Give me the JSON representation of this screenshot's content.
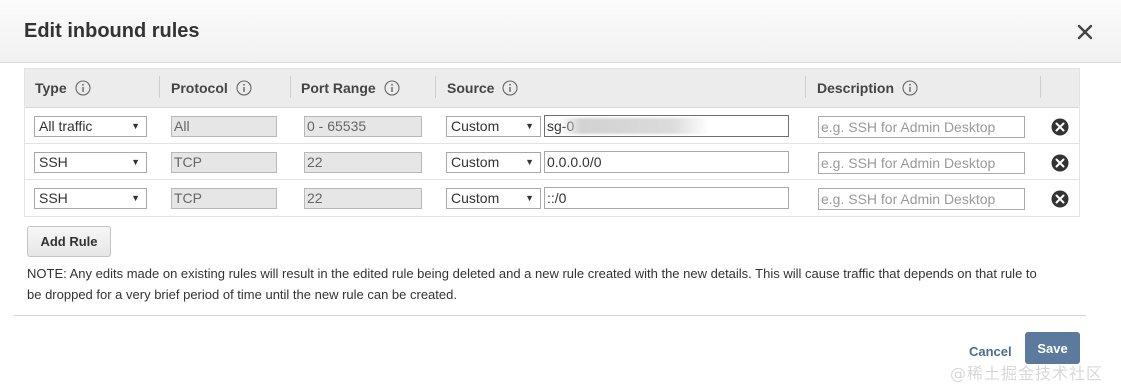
{
  "dialog": {
    "title": "Edit inbound rules"
  },
  "table": {
    "headers": {
      "type": "Type",
      "protocol": "Protocol",
      "port_range": "Port Range",
      "source": "Source",
      "description": "Description"
    },
    "rows": [
      {
        "type": "All traffic",
        "protocol": "All",
        "port_range": "0 - 65535",
        "source_type": "Custom",
        "source_value": "sg-0",
        "source_value_redacted": true,
        "description_placeholder": "e.g. SSH for Admin Desktop"
      },
      {
        "type": "SSH",
        "protocol": "TCP",
        "port_range": "22",
        "source_type": "Custom",
        "source_value": "0.0.0.0/0",
        "source_value_redacted": false,
        "description_placeholder": "e.g. SSH for Admin Desktop"
      },
      {
        "type": "SSH",
        "protocol": "TCP",
        "port_range": "22",
        "source_type": "Custom",
        "source_value": "::/0",
        "source_value_redacted": false,
        "description_placeholder": "e.g. SSH for Admin Desktop"
      }
    ]
  },
  "actions": {
    "add_rule_label": "Add Rule",
    "cancel_label": "Cancel",
    "save_label": "Save"
  },
  "note": "NOTE: Any edits made on existing rules will result in the edited rule being deleted and a new rule created with the new details. This will cause traffic that depends on that rule to be dropped for a very brief period of time until the new rule can be created.",
  "watermark": "@稀土掘金技术社区",
  "icons": {
    "close": "close-icon",
    "info": "info-icon",
    "delete": "remove-circle-icon",
    "dropdown": "chevron-down-icon"
  },
  "colors": {
    "primary_button": "#5b7a9d",
    "link": "#4a6e91",
    "header_bg": "#ececec"
  }
}
